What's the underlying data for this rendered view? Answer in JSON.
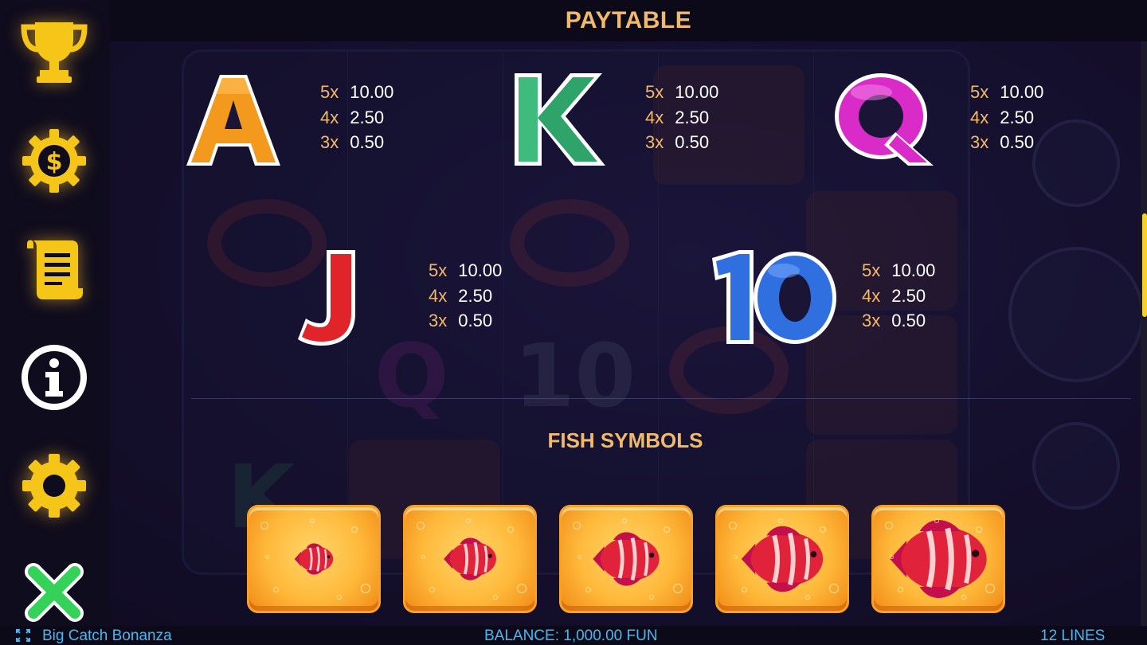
{
  "header": {
    "title": "PAYTABLE"
  },
  "left_rail": {
    "icons": [
      "trophy-icon",
      "coin-gear-icon",
      "scroll-icon",
      "info-icon",
      "settings-gear-icon",
      "close-icon"
    ]
  },
  "paytable": {
    "symbols": [
      {
        "symbol": "A",
        "color": "#f39a1e",
        "pays": [
          {
            "mult": "5x",
            "value": "10.00"
          },
          {
            "mult": "4x",
            "value": "2.50"
          },
          {
            "mult": "3x",
            "value": "0.50"
          }
        ]
      },
      {
        "symbol": "K",
        "color": "#2ea36a",
        "pays": [
          {
            "mult": "5x",
            "value": "10.00"
          },
          {
            "mult": "4x",
            "value": "2.50"
          },
          {
            "mult": "3x",
            "value": "0.50"
          }
        ]
      },
      {
        "symbol": "Q",
        "color": "#d82bc8",
        "pays": [
          {
            "mult": "5x",
            "value": "10.00"
          },
          {
            "mult": "4x",
            "value": "2.50"
          },
          {
            "mult": "3x",
            "value": "0.50"
          }
        ]
      },
      {
        "symbol": "J",
        "color": "#e0242a",
        "pays": [
          {
            "mult": "5x",
            "value": "10.00"
          },
          {
            "mult": "4x",
            "value": "2.50"
          },
          {
            "mult": "3x",
            "value": "0.50"
          }
        ]
      },
      {
        "symbol": "10",
        "color": "#2f6fe0",
        "pays": [
          {
            "mult": "5x",
            "value": "10.00"
          },
          {
            "mult": "4x",
            "value": "2.50"
          },
          {
            "mult": "3x",
            "value": "0.50"
          }
        ]
      }
    ]
  },
  "fish_section": {
    "title": "FISH SYMBOLS",
    "tile_count": 5
  },
  "footer": {
    "game_name": "Big Catch Bonanza",
    "balance": "BALANCE: 1,000.00 FUN",
    "lines": "12 LINES"
  },
  "colors": {
    "accent_gold": "#f3b96b",
    "footer_blue": "#49b8f0",
    "rail_yellow": "#f5c518",
    "close_green": "#35d25a"
  }
}
